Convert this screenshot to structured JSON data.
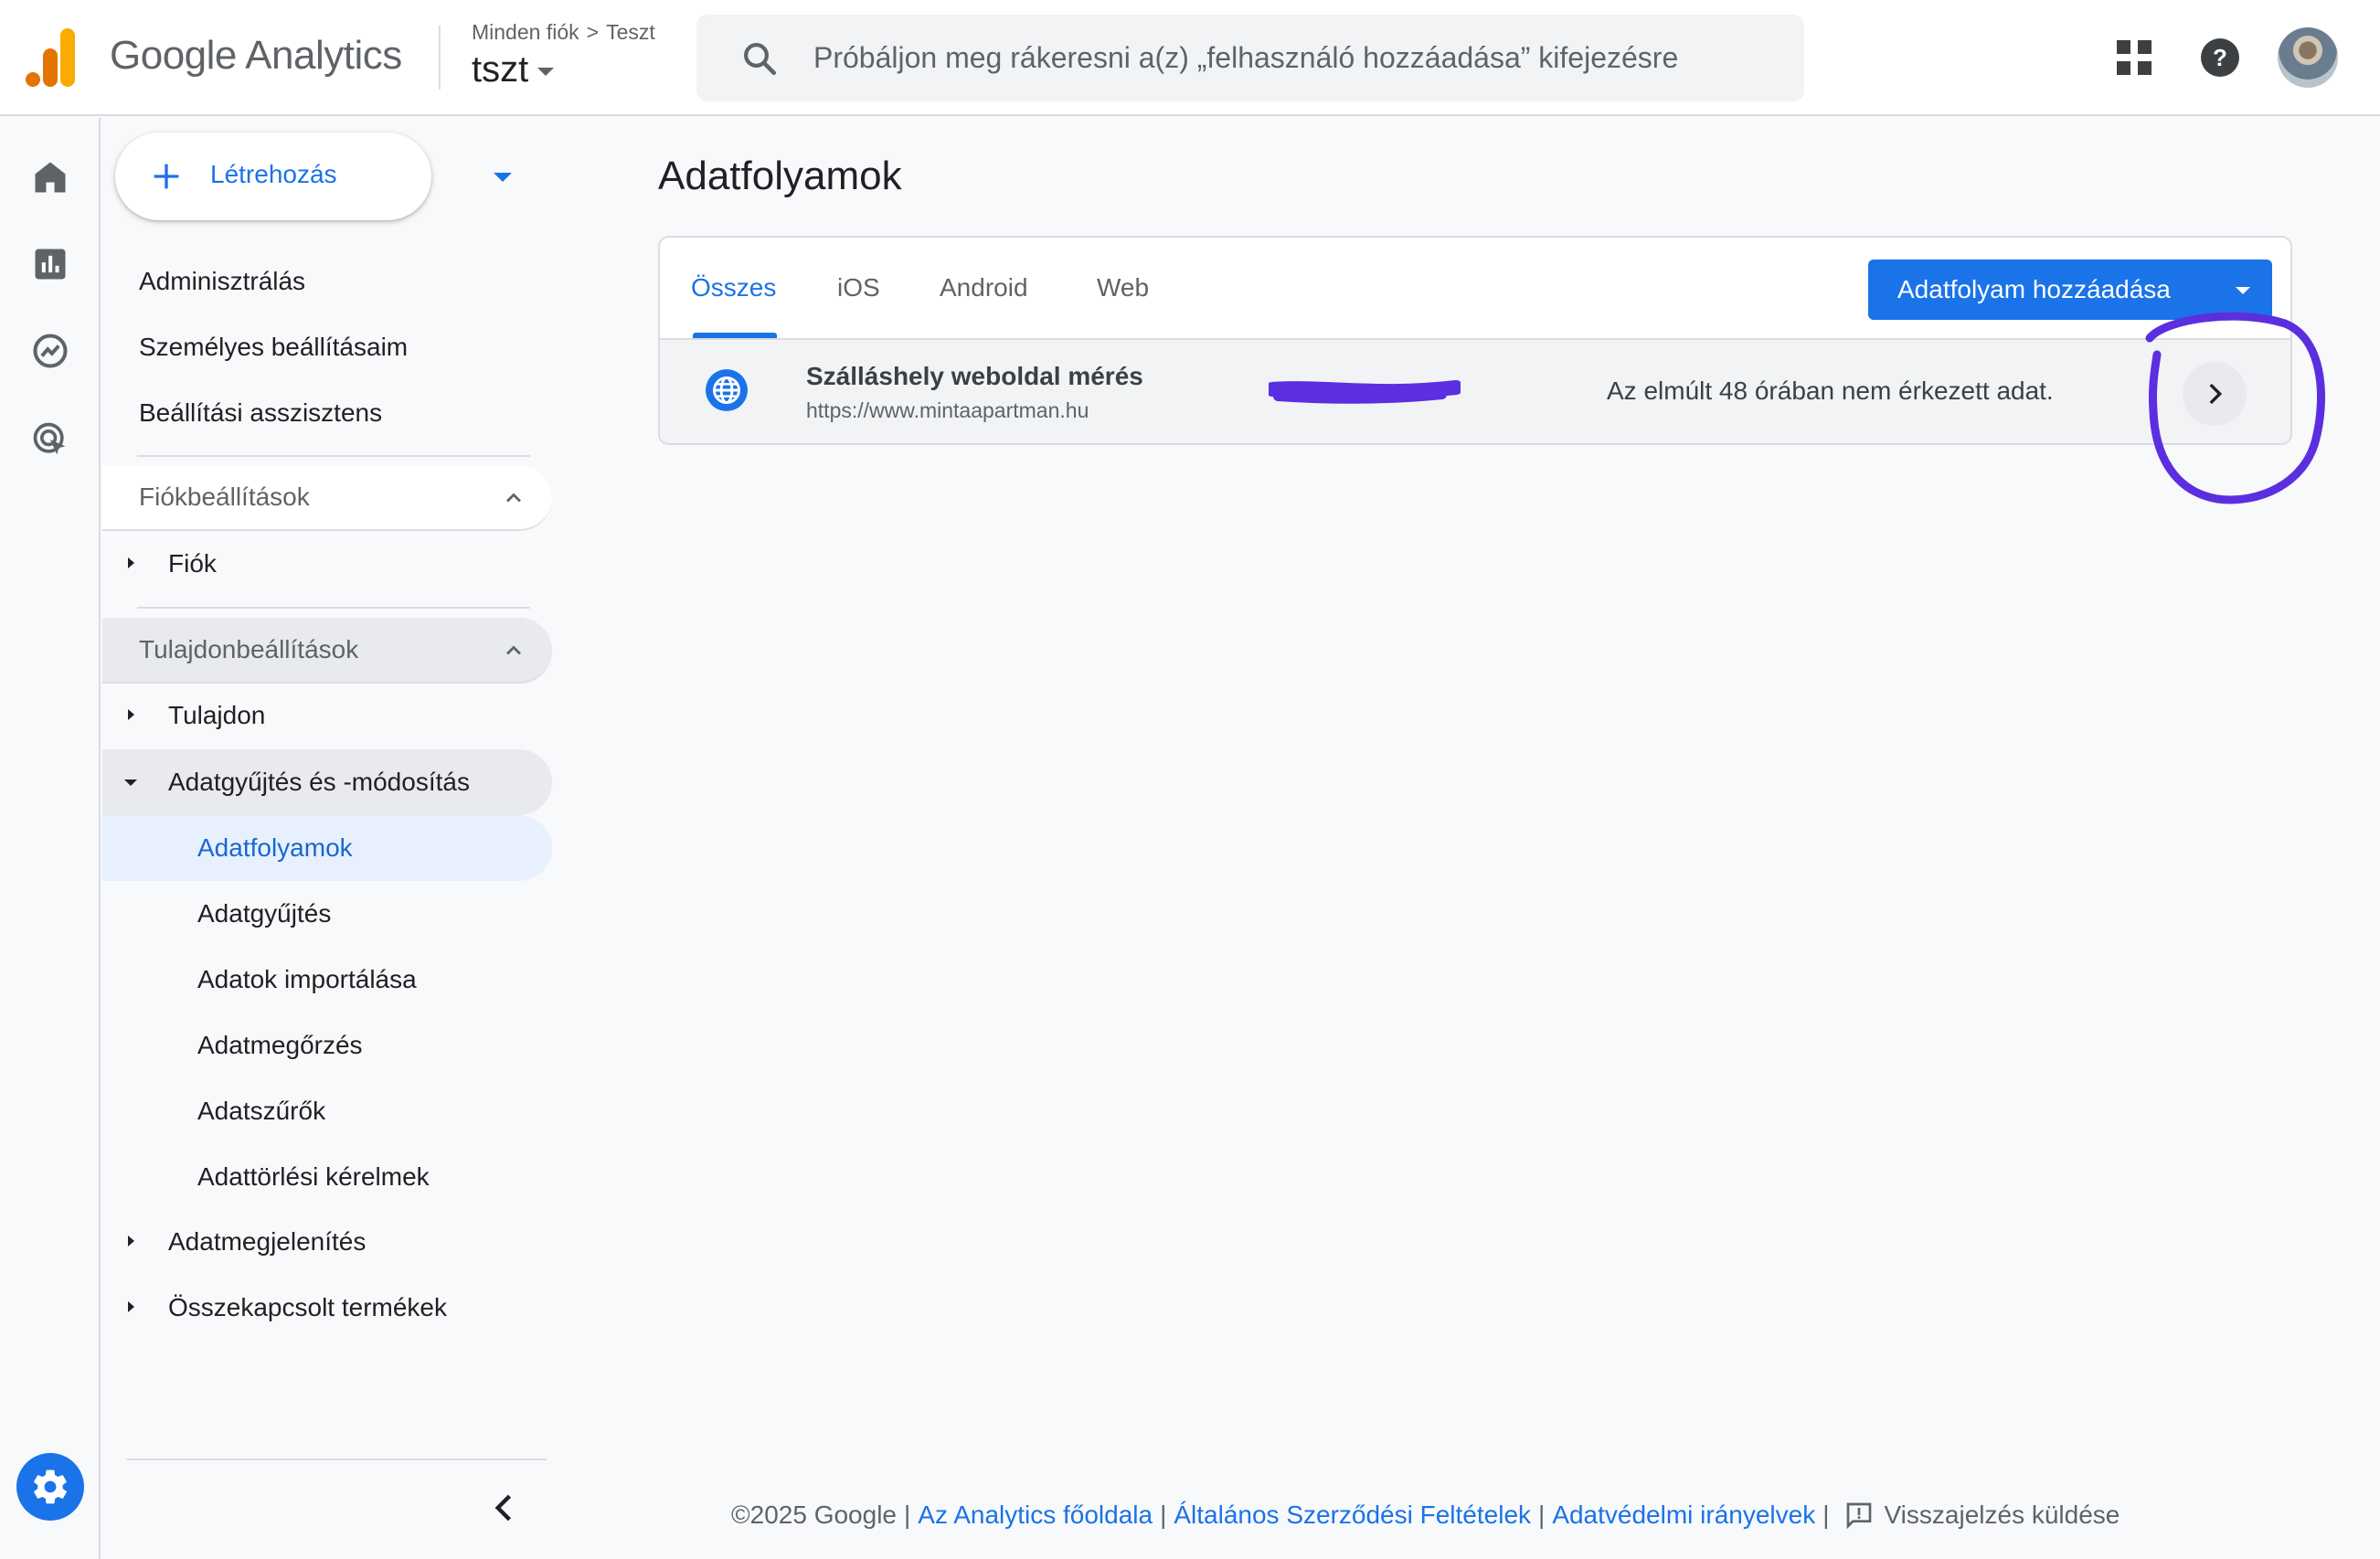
{
  "header": {
    "app_name": "Google Analytics",
    "breadcrumb": {
      "root": "Minden fiók",
      "account": "Teszt"
    },
    "property": "tszt",
    "search_placeholder": "Próbáljon meg rákeresni a(z) „felhasználó hozzáadása” kifejezésre"
  },
  "rail": {
    "icons": [
      "home-icon",
      "reports-icon",
      "explore-icon",
      "advertising-icon"
    ],
    "settings_icon": "gear-icon"
  },
  "nav": {
    "create_label": "Létrehozás",
    "admin": "Adminisztrálás",
    "personal": "Személyes beállításaim",
    "assistant": "Beállítási asszisztens",
    "account_section": "Fiókbeállítások",
    "account_item": "Fiók",
    "property_section": "Tulajdonbeállítások",
    "property_item": "Tulajdon",
    "data_collection": "Adatgyűjtés és -módosítás",
    "sub_items": [
      "Adatfolyamok",
      "Adatgyűjtés",
      "Adatok importálása",
      "Adatmegőrzés",
      "Adatszűrők",
      "Adattörlési kérelmek"
    ],
    "display": "Adatmegjelenítés",
    "linked": "Összekapcsolt termékek"
  },
  "main": {
    "title": "Adatfolyamok",
    "tabs": [
      "Összes",
      "iOS",
      "Android",
      "Web"
    ],
    "active_tab": "Összes",
    "add_button": "Adatfolyam hozzáadása",
    "stream": {
      "name": "Szálláshely weboldal mérés",
      "url": "https://www.mintaapartman.hu",
      "status": "Az elmúlt 48 órában nem érkezett adat."
    }
  },
  "footer": {
    "copyright": "©2025 Google",
    "home_link": "Az Analytics főoldala",
    "terms_link": "Általános Szerződési Feltételek",
    "privacy_link": "Adatvédelmi irányelvek",
    "feedback": "Visszajelzés küldése"
  },
  "colors": {
    "accent": "#1a73e8",
    "active_bg": "#e8f0fe",
    "annotation": "#5b2fe0",
    "logo_orange": "#f9ab00",
    "logo_dark": "#e37400"
  }
}
